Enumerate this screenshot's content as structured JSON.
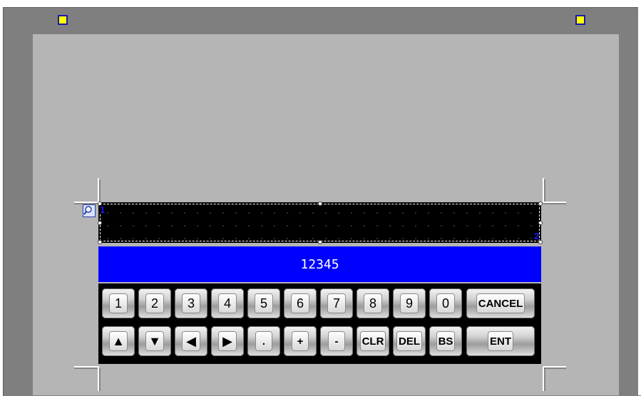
{
  "display": {
    "value": "12345",
    "marker_start": "1",
    "marker_end": "2"
  },
  "keypad": {
    "row1": [
      "1",
      "2",
      "3",
      "4",
      "5",
      "6",
      "7",
      "8",
      "9",
      "0",
      "CANCEL"
    ],
    "row2": [
      "▲",
      "▼",
      "◀",
      "▶",
      ".",
      "+",
      "-",
      "CLR",
      "DEL",
      "BS",
      "ENT"
    ]
  },
  "colors": {
    "handle_fill": "#ffff00",
    "handle_border": "#1a1aa8",
    "value_bar": "#0000ff",
    "display_bg": "#000000"
  },
  "icons": {
    "search": "search-icon",
    "handle": "resize-handle-icon"
  }
}
